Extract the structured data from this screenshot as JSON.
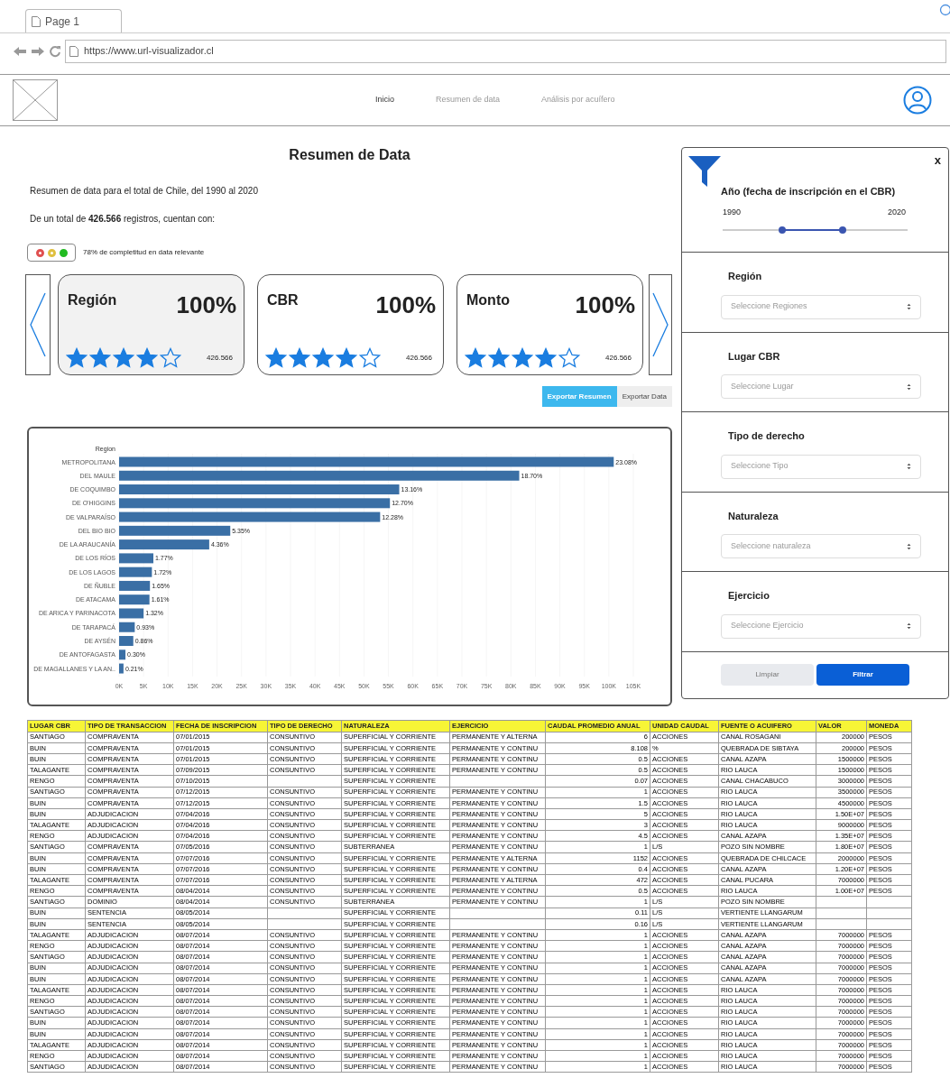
{
  "browser": {
    "tab": "Page 1",
    "url": "https://www.url-visualizador.cl"
  },
  "nav": [
    {
      "label": "Inicio",
      "selected": true
    },
    {
      "label": "Resumen de data",
      "selected": false
    },
    {
      "label": "Análisis por acuífero",
      "selected": false
    }
  ],
  "title": "Resumen de Data",
  "description": "Resumen de data para el total de Chile, del 1990 al 2020",
  "records_text": "De un total de **426.566** registros, cuentan con:",
  "completeness": {
    "lights": [
      {
        "color": "#e05050",
        "on": false
      },
      {
        "color": "#e0c040",
        "on": false
      },
      {
        "color": "#22bb22",
        "on": true
      }
    ],
    "text": "78% de completitud en data relevante"
  },
  "cards": [
    {
      "title": "Región",
      "percent": "100%",
      "stars": 4,
      "count": "426.566",
      "selected": true
    },
    {
      "title": "CBR",
      "percent": "100%",
      "stars": 4,
      "count": "426.566",
      "selected": false
    },
    {
      "title": "Monto",
      "percent": "100%",
      "stars": 4,
      "count": "426.566",
      "selected": false
    }
  ],
  "export_buttons": [
    {
      "label": "Exportar Resumen",
      "selected": true
    },
    {
      "label": "Exportar Data",
      "selected": false
    }
  ],
  "chart_data": {
    "type": "bar",
    "orientation": "horizontal",
    "ylabel": "Region",
    "categories": [
      "METROPOLITANA",
      "DEL MAULE",
      "DE COQUIMBO",
      "DE O'HIGGINS",
      "DE VALPARAÍSO",
      "DEL BIO BIO",
      "DE LA ARAUCANÍA",
      "DE LOS RÍOS",
      "DE LOS LAGOS",
      "DE ÑUBLE",
      "DE ATACAMA",
      "DE ARICA Y PARINACOTA",
      "DE TARAPACÁ",
      "DE AYSÉN",
      "DE ANTOFAGASTA",
      "DE MAGALLANES Y LA AN.."
    ],
    "grid": true,
    "series": [
      {
        "color": "#3a6fa5",
        "values": [
          101,
          81.7,
          57.2,
          55.3,
          53.3,
          22.7,
          18.4,
          7.0,
          6.7,
          6.3,
          6.2,
          5.0,
          3.2,
          2.9,
          1.3,
          0.9
        ]
      }
    ],
    "value_labels": [
      "23.08%",
      "18.70%",
      "13.16%",
      "12.70%",
      "12.28%",
      "5.35%",
      "4.36%",
      "1.77%",
      "1.72%",
      "1.65%",
      "1.61%",
      "1.32%",
      "0.93%",
      "0.86%",
      "0.30%",
      "0.21%"
    ],
    "xlim": [
      0,
      105
    ],
    "xticks": [
      {
        "value": 0,
        "label": "0K"
      },
      {
        "value": 5,
        "label": "5K"
      },
      {
        "value": 10,
        "label": "10K"
      },
      {
        "value": 15,
        "label": "15K"
      },
      {
        "value": 20,
        "label": "20K"
      },
      {
        "value": 25,
        "label": "25K"
      },
      {
        "value": 30,
        "label": "30K"
      },
      {
        "value": 35,
        "label": "35K"
      },
      {
        "value": 40,
        "label": "40K"
      },
      {
        "value": 45,
        "label": "45K"
      },
      {
        "value": 50,
        "label": "50K"
      },
      {
        "value": 55,
        "label": "55K"
      },
      {
        "value": 60,
        "label": "60K"
      },
      {
        "value": 65,
        "label": "65K"
      },
      {
        "value": 70,
        "label": "70K"
      },
      {
        "value": 75,
        "label": "75K"
      },
      {
        "value": 80,
        "label": "80K"
      },
      {
        "value": 85,
        "label": "85K"
      },
      {
        "value": 90,
        "label": "90K"
      },
      {
        "value": 95,
        "label": "95K"
      },
      {
        "value": 100,
        "label": "100K"
      },
      {
        "value": 105,
        "label": "105K"
      }
    ]
  },
  "table": {
    "columns": [
      "LUGAR CBR",
      "TIPO DE TRANSACCION",
      "FECHA DE INSCRIPCION",
      "TIPO DE DERECHO",
      "NATURALEZA",
      "EJERCICIO",
      "CAUDAL PROMEDIO ANUAL",
      "UNIDAD CAUDAL",
      "FUENTE O ACUIFERO",
      "VALOR",
      "MONEDA"
    ],
    "rows": [
      [
        "SANTIAGO",
        "COMPRAVENTA",
        "07/01/2015",
        "CONSUNTIVO",
        "SUPERFICIAL Y CORRIENTE",
        "PERMANENTE Y ALTERNA",
        "6",
        "ACCIONES",
        "CANAL ROSAGANI",
        "200000",
        "PESOS"
      ],
      [
        "BUIN",
        "COMPRAVENTA",
        "07/01/2015",
        "CONSUNTIVO",
        "SUPERFICIAL Y CORRIENTE",
        "PERMANENTE Y CONTINU",
        "8.108",
        "%",
        "QUEBRADA DE SIBTAYA",
        "200000",
        "PESOS"
      ],
      [
        "BUIN",
        "COMPRAVENTA",
        "07/01/2015",
        "CONSUNTIVO",
        "SUPERFICIAL Y CORRIENTE",
        "PERMANENTE Y CONTINU",
        "0.5",
        "ACCIONES",
        "CANAL AZAPA",
        "1500000",
        "PESOS"
      ],
      [
        "TALAGANTE",
        "COMPRAVENTA",
        "07/09/2015",
        "CONSUNTIVO",
        "SUPERFICIAL Y CORRIENTE",
        "PERMANENTE Y CONTINU",
        "0.5",
        "ACCIONES",
        "RIO LAUCA",
        "1500000",
        "PESOS"
      ],
      [
        "RENGO",
        "COMPRAVENTA",
        "07/10/2015",
        "",
        "SUPERFICIAL Y CORRIENTE",
        "",
        "0.07",
        "ACCIONES",
        "CANAL CHACABUCO",
        "3000000",
        "PESOS"
      ],
      [
        "SANTIAGO",
        "COMPRAVENTA",
        "07/12/2015",
        "CONSUNTIVO",
        "SUPERFICIAL Y CORRIENTE",
        "PERMANENTE Y CONTINU",
        "1",
        "ACCIONES",
        "RIO LAUCA",
        "3500000",
        "PESOS"
      ],
      [
        "BUIN",
        "COMPRAVENTA",
        "07/12/2015",
        "CONSUNTIVO",
        "SUPERFICIAL Y CORRIENTE",
        "PERMANENTE Y CONTINU",
        "1.5",
        "ACCIONES",
        "RIO LAUCA",
        "4500000",
        "PESOS"
      ],
      [
        "BUIN",
        "ADJUDICACION",
        "07/04/2016",
        "CONSUNTIVO",
        "SUPERFICIAL Y CORRIENTE",
        "PERMANENTE Y CONTINU",
        "5",
        "ACCIONES",
        "RIO LAUCA",
        "1.50E+07",
        "PESOS"
      ],
      [
        "TALAGANTE",
        "ADJUDICACION",
        "07/04/2016",
        "CONSUNTIVO",
        "SUPERFICIAL Y CORRIENTE",
        "PERMANENTE Y CONTINU",
        "3",
        "ACCIONES",
        "RIO LAUCA",
        "9000000",
        "PESOS"
      ],
      [
        "RENGO",
        "ADJUDICACION",
        "07/04/2016",
        "CONSUNTIVO",
        "SUPERFICIAL Y CORRIENTE",
        "PERMANENTE Y CONTINU",
        "4.5",
        "ACCIONES",
        "CANAL AZAPA",
        "1.35E+07",
        "PESOS"
      ],
      [
        "SANTIAGO",
        "COMPRAVENTA",
        "07/05/2016",
        "CONSUNTIVO",
        "SUBTERRANEA",
        "PERMANENTE Y CONTINU",
        "1",
        "L/S",
        "POZO SIN NOMBRE",
        "1.80E+07",
        "PESOS"
      ],
      [
        "BUIN",
        "COMPRAVENTA",
        "07/07/2016",
        "CONSUNTIVO",
        "SUPERFICIAL Y CORRIENTE",
        "PERMANENTE Y ALTERNA",
        "1152",
        "ACCIONES",
        "QUEBRADA DE CHILCACE",
        "2000000",
        "PESOS"
      ],
      [
        "BUIN",
        "COMPRAVENTA",
        "07/07/2016",
        "CONSUNTIVO",
        "SUPERFICIAL Y CORRIENTE",
        "PERMANENTE Y CONTINU",
        "0.4",
        "ACCIONES",
        "CANAL AZAPA",
        "1.20E+07",
        "PESOS"
      ],
      [
        "TALAGANTE",
        "COMPRAVENTA",
        "07/07/2016",
        "CONSUNTIVO",
        "SUPERFICIAL Y CORRIENTE",
        "PERMANENTE Y ALTERNA",
        "472",
        "ACCIONES",
        "CANAL PUCARA",
        "7000000",
        "PESOS"
      ],
      [
        "RENGO",
        "COMPRAVENTA",
        "08/04/2014",
        "CONSUNTIVO",
        "SUPERFICIAL Y CORRIENTE",
        "PERMANENTE Y CONTINU",
        "0.5",
        "ACCIONES",
        "RIO LAUCA",
        "1.00E+07",
        "PESOS"
      ],
      [
        "SANTIAGO",
        "DOMINIO",
        "08/04/2014",
        "CONSUNTIVO",
        "SUBTERRANEA",
        "PERMANENTE Y CONTINU",
        "1",
        "L/S",
        "POZO SIN NOMBRE",
        "",
        ""
      ],
      [
        "BUIN",
        "SENTENCIA",
        "08/05/2014",
        "",
        "SUPERFICIAL Y CORRIENTE",
        "",
        "0.11",
        "L/S",
        "VERTIENTE LLANGARUM",
        "",
        ""
      ],
      [
        "BUIN",
        "SENTENCIA",
        "08/05/2014",
        "",
        "SUPERFICIAL Y CORRIENTE",
        "",
        "0.16",
        "L/S",
        "VERTIENTE LLANGARUM",
        "",
        ""
      ],
      [
        "TALAGANTE",
        "ADJUDICACION",
        "08/07/2014",
        "CONSUNTIVO",
        "SUPERFICIAL Y CORRIENTE",
        "PERMANENTE Y CONTINU",
        "1",
        "ACCIONES",
        "CANAL AZAPA",
        "7000000",
        "PESOS"
      ],
      [
        "RENGO",
        "ADJUDICACION",
        "08/07/2014",
        "CONSUNTIVO",
        "SUPERFICIAL Y CORRIENTE",
        "PERMANENTE Y CONTINU",
        "1",
        "ACCIONES",
        "CANAL AZAPA",
        "7000000",
        "PESOS"
      ],
      [
        "SANTIAGO",
        "ADJUDICACION",
        "08/07/2014",
        "CONSUNTIVO",
        "SUPERFICIAL Y CORRIENTE",
        "PERMANENTE Y CONTINU",
        "1",
        "ACCIONES",
        "CANAL AZAPA",
        "7000000",
        "PESOS"
      ],
      [
        "BUIN",
        "ADJUDICACION",
        "08/07/2014",
        "CONSUNTIVO",
        "SUPERFICIAL Y CORRIENTE",
        "PERMANENTE Y CONTINU",
        "1",
        "ACCIONES",
        "CANAL AZAPA",
        "7000000",
        "PESOS"
      ],
      [
        "BUIN",
        "ADJUDICACION",
        "08/07/2014",
        "CONSUNTIVO",
        "SUPERFICIAL Y CORRIENTE",
        "PERMANENTE Y CONTINU",
        "1",
        "ACCIONES",
        "CANAL AZAPA",
        "7000000",
        "PESOS"
      ],
      [
        "TALAGANTE",
        "ADJUDICACION",
        "08/07/2014",
        "CONSUNTIVO",
        "SUPERFICIAL Y CORRIENTE",
        "PERMANENTE Y CONTINU",
        "1",
        "ACCIONES",
        "RIO LAUCA",
        "7000000",
        "PESOS"
      ],
      [
        "RENGO",
        "ADJUDICACION",
        "08/07/2014",
        "CONSUNTIVO",
        "SUPERFICIAL Y CORRIENTE",
        "PERMANENTE Y CONTINU",
        "1",
        "ACCIONES",
        "RIO LAUCA",
        "7000000",
        "PESOS"
      ],
      [
        "SANTIAGO",
        "ADJUDICACION",
        "08/07/2014",
        "CONSUNTIVO",
        "SUPERFICIAL Y CORRIENTE",
        "PERMANENTE Y CONTINU",
        "1",
        "ACCIONES",
        "RIO LAUCA",
        "7000000",
        "PESOS"
      ],
      [
        "BUIN",
        "ADJUDICACION",
        "08/07/2014",
        "CONSUNTIVO",
        "SUPERFICIAL Y CORRIENTE",
        "PERMANENTE Y CONTINU",
        "1",
        "ACCIONES",
        "RIO LAUCA",
        "7000000",
        "PESOS"
      ],
      [
        "BUIN",
        "ADJUDICACION",
        "08/07/2014",
        "CONSUNTIVO",
        "SUPERFICIAL Y CORRIENTE",
        "PERMANENTE Y CONTINU",
        "1",
        "ACCIONES",
        "RIO LAUCA",
        "7000000",
        "PESOS"
      ],
      [
        "TALAGANTE",
        "ADJUDICACION",
        "08/07/2014",
        "CONSUNTIVO",
        "SUPERFICIAL Y CORRIENTE",
        "PERMANENTE Y CONTINU",
        "1",
        "ACCIONES",
        "RIO LAUCA",
        "7000000",
        "PESOS"
      ],
      [
        "RENGO",
        "ADJUDICACION",
        "08/07/2014",
        "CONSUNTIVO",
        "SUPERFICIAL Y CORRIENTE",
        "PERMANENTE Y CONTINU",
        "1",
        "ACCIONES",
        "RIO LAUCA",
        "7000000",
        "PESOS"
      ],
      [
        "SANTIAGO",
        "ADJUDICACION",
        "08/07/2014",
        "CONSUNTIVO",
        "SUPERFICIAL Y CORRIENTE",
        "PERMANENTE Y CONTINU",
        "1",
        "ACCIONES",
        "RIO LAUCA",
        "7000000",
        "PESOS"
      ]
    ]
  },
  "filters": {
    "close": "x",
    "year": {
      "label": "Año (fecha de inscripción en el CBR)",
      "min": "1990",
      "max": "2020",
      "handles": [
        {
          "level": 0.32
        },
        {
          "level": 0.65
        }
      ]
    },
    "selects": [
      {
        "label": "Región",
        "placeholder": "Seleccione Regiones"
      },
      {
        "label": "Lugar CBR",
        "placeholder": "Seleccione Lugar"
      },
      {
        "label": "Tipo de derecho",
        "placeholder": "Seleccione Tipo"
      },
      {
        "label": "Naturaleza",
        "placeholder": "Seleccione naturaleza"
      },
      {
        "label": "Ejercicio",
        "placeholder": "Seleccione Ejercicio"
      }
    ],
    "buttons": [
      {
        "label": "Limpiar",
        "kind": "secondary"
      },
      {
        "label": "Filtrar",
        "kind": "primary"
      }
    ]
  }
}
